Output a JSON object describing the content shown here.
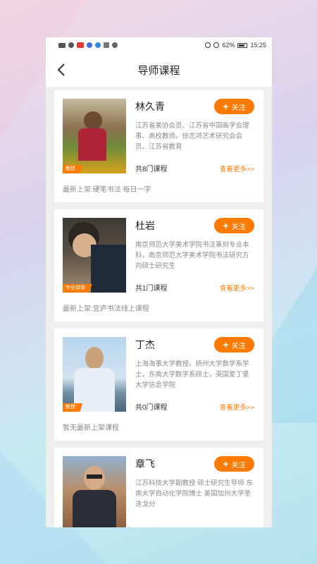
{
  "status_bar": {
    "left_icons": [
      "signal-icon",
      "wifi-icon",
      "app-notification-icon",
      "shield-icon",
      "browser-icon",
      "text-icon",
      "heart-icon"
    ],
    "battery": "62%",
    "time": "15:25"
  },
  "header": {
    "title": "导师课程"
  },
  "teachers": [
    {
      "name": "林久青",
      "badge": "教授",
      "desc": "江苏省美协会员、江苏省中国画学会理事、高校教师。徐志鸿艺术研究会会员、江苏省教育",
      "count": "共8门课程",
      "more": "查看更多>>",
      "latest": "最新上架:硬笔书法 每日一字",
      "follow": "关注"
    },
    {
      "name": "杜岩",
      "badge": "专业讲师",
      "desc": "南京师范大学美术学院书法篆刻专业本科，南京师范大学美术学院书法研究方向硕士研究生",
      "count": "共1门课程",
      "more": "查看更多>>",
      "latest": "最新上架:宜庐书法线上课程",
      "follow": "关注"
    },
    {
      "name": "丁杰",
      "badge": "教授",
      "desc": "上海海事大学教授。扬州大学数学系学士，东南大学数学系硕士，英国爱丁堡大学信息学院",
      "count": "共0门课程",
      "more": "查看更多>>",
      "latest": "暂无最新上架课程",
      "follow": "关注"
    },
    {
      "name": "章飞",
      "badge": "",
      "desc": "江苏科技大学副教授 硕士研究生导师 东南大学自动化学院博士 美国加州大学圣迭戈分",
      "count": "",
      "more": "",
      "latest": "",
      "follow": "关注"
    }
  ],
  "colors": {
    "accent": "#ff7a00"
  }
}
